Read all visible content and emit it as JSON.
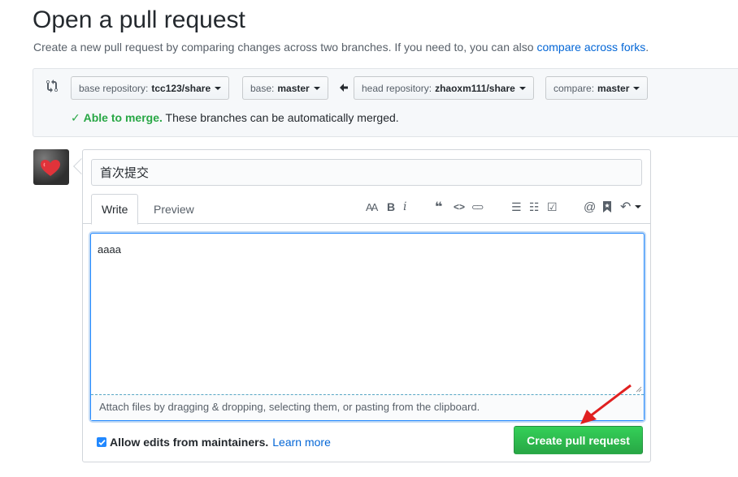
{
  "page": {
    "title": "Open a pull request",
    "subtitle_text": "Create a new pull request by comparing changes across two branches. If you need to, you can also ",
    "compare_forks_link": "compare across forks",
    "subtitle_end": "."
  },
  "range": {
    "base_repo_label": "base repository:",
    "base_repo_value": "tcc123/share",
    "base_label": "base:",
    "base_value": "master",
    "head_repo_label": "head repository:",
    "head_repo_value": "zhaoxm111/share",
    "compare_label": "compare:",
    "compare_value": "master",
    "merge_status": "Able to merge.",
    "merge_message": " These branches can be automatically merged."
  },
  "form": {
    "title_value": "首次提交",
    "tab_write": "Write",
    "tab_preview": "Preview",
    "toolbar": {
      "header": "AA",
      "bold": "B",
      "italic": "i",
      "quote": "❝",
      "code": "<>",
      "link": "⊂⊃",
      "ul": "☰",
      "ol": "☷",
      "task": "☑",
      "mention": "@",
      "saved": "bookmark",
      "reply": "↶"
    },
    "body_value": "aaaa",
    "drop_text": "Attach files by dragging & dropping, selecting them, or pasting from the clipboard.",
    "allow_edits_label": "Allow edits from maintainers.",
    "learn_more": "Learn more",
    "create_button": "Create pull request"
  },
  "colors": {
    "green": "#28a745",
    "link": "#0366d6",
    "focus": "#2188ff",
    "annotation_arrow": "#e02020"
  }
}
